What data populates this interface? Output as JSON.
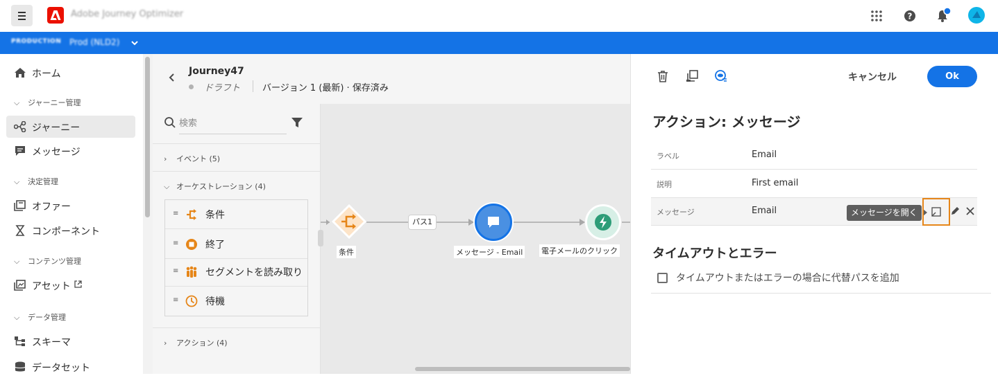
{
  "app": {
    "title": "Adobe Journey Optimizer"
  },
  "env": {
    "label": "PRODUCTION",
    "value": "Prod (NLD2)"
  },
  "topbar_icons": [
    "apps-grid-icon",
    "help-icon",
    "notification-bell-icon",
    "user-avatar"
  ],
  "sidebar": {
    "items": [
      {
        "label": "ホーム",
        "icon": "home-icon"
      },
      {
        "label": "ジャーニー",
        "icon": "journey-icon"
      },
      {
        "label": "メッセージ",
        "icon": "message-icon"
      },
      {
        "label": "オファー",
        "icon": "offer-icon"
      },
      {
        "label": "コンポーネント",
        "icon": "component-icon"
      },
      {
        "label": "アセット",
        "icon": "asset-icon"
      },
      {
        "label": "スキーマ",
        "icon": "schema-icon"
      },
      {
        "label": "データセット",
        "icon": "dataset-icon"
      }
    ],
    "groups": [
      "ジャーニー管理",
      "決定管理",
      "コンテンツ管理",
      "データ管理"
    ],
    "active": "ジャーニー"
  },
  "journey": {
    "name": "Journey47",
    "status": "ドラフト",
    "version": "バージョン 1 (最新) · 保存済み"
  },
  "palette": {
    "search_placeholder": "検索",
    "categories": {
      "events": "イベント (5)",
      "orchestration": "オーケストレーション (4)",
      "actions": "アクション (4)"
    },
    "orchestration_items": [
      {
        "label": "条件",
        "icon": "condition-icon"
      },
      {
        "label": "終了",
        "icon": "end-icon"
      },
      {
        "label": "セグメントを読み取り",
        "icon": "read-segment-icon"
      },
      {
        "label": "待機",
        "icon": "wait-icon"
      }
    ]
  },
  "canvas": {
    "nodes": [
      {
        "label": "条件",
        "icon": "condition-node-icon"
      },
      {
        "label": "メッセージ - Email",
        "icon": "message-node-icon"
      },
      {
        "label": "電子メールのクリック",
        "icon": "email-click-node-icon"
      }
    ],
    "path_label": "パス1"
  },
  "panel": {
    "tools": [
      "delete-icon",
      "duplicate-icon",
      "view-icon"
    ],
    "cancel": "キャンセル",
    "ok": "Ok",
    "title": "アクション: メッセージ",
    "rows": [
      {
        "key": "ラベル",
        "value": "Email"
      },
      {
        "key": "説明",
        "value": "First email"
      },
      {
        "key": "メッセージ",
        "value": "Email"
      }
    ],
    "tooltip": "メッセージを開く",
    "timeout_title": "タイムアウトとエラー",
    "timeout_checkbox": "タイムアウトまたはエラーの場合に代替パスを追加",
    "timeout_checked": false
  },
  "colors": {
    "accent": "#1473e6",
    "orange": "#e68619",
    "green": "#2d9d78",
    "highlight": "#e68619"
  }
}
